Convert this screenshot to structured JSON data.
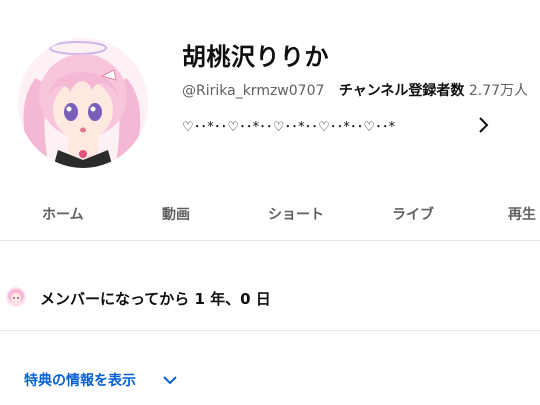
{
  "channel": {
    "name": "胡桃沢りりか",
    "handle": "@Ririka_krmzw0707",
    "subscribers_label": "チャンネル登録者数",
    "subscribers_count": "2.77万人",
    "description": "♡･･*･･♡･･*･･♡･･*･･♡･･*･･♡･･*"
  },
  "tabs": [
    {
      "label": "ホーム"
    },
    {
      "label": "動画"
    },
    {
      "label": "ショート"
    },
    {
      "label": "ライブ"
    },
    {
      "label": "再生"
    }
  ],
  "membership": {
    "text": "メンバーになってから 1 年、0 日"
  },
  "perks": {
    "label": "特典の情報を表示"
  },
  "colors": {
    "link": "#065fd4",
    "divider": "#e5e5e5",
    "secondary_text": "#606060"
  },
  "icons": {
    "description_more": "chevron-right-icon",
    "perks_expand": "chevron-down-icon"
  }
}
